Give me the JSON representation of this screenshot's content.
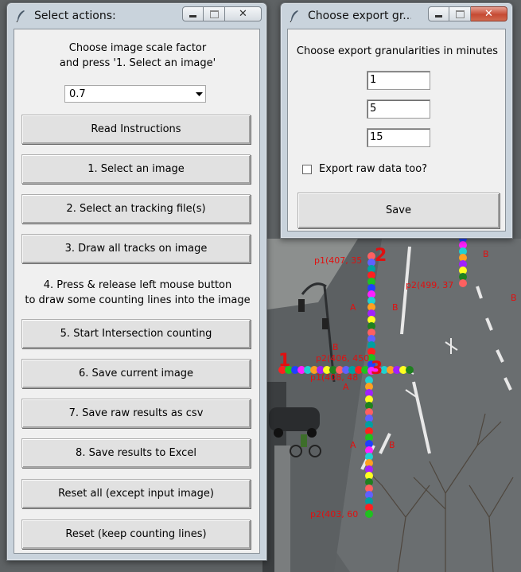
{
  "background": {
    "labels": [
      {
        "text": "p1(407, 35"
      },
      {
        "text": "p2(499, 37"
      },
      {
        "text": "p2(406, 450"
      },
      {
        "text": "p1(408, 48"
      },
      {
        "text": "p2(403, 60"
      },
      {
        "text": "A"
      },
      {
        "text": "B"
      },
      {
        "text": "B"
      },
      {
        "text": "B"
      },
      {
        "text": "A"
      },
      {
        "text": "A"
      },
      {
        "text": "B"
      },
      {
        "text": "B"
      }
    ],
    "line_numbers": [
      "1",
      "2",
      "3"
    ]
  },
  "select_window": {
    "title": "Select actions:",
    "instruction": "Choose image scale factor\nand press '1. Select an image'",
    "scale_value": "0.7",
    "buttons": {
      "read_instructions": "Read Instructions",
      "select_image": "1. Select an image",
      "select_tracking": "2. Select an tracking file(s)",
      "draw_tracks": "3. Draw all tracks on image",
      "start_counting": "5. Start Intersection counting",
      "save_image": "6. Save current image",
      "save_raw_csv": "7. Save raw results as csv",
      "save_excel": "8. Save results to Excel",
      "reset_all": "Reset all (except input image)",
      "reset_keep": "Reset (keep counting lines)"
    },
    "step4_text": "4. Press & release left mouse button\nto draw some counting lines into the image"
  },
  "export_window": {
    "title": "Choose export gr...",
    "heading": "Choose export granularities in minutes",
    "granularities": [
      "1",
      "5",
      "15"
    ],
    "checkbox_label": "Export raw data too?",
    "save_label": "Save"
  }
}
